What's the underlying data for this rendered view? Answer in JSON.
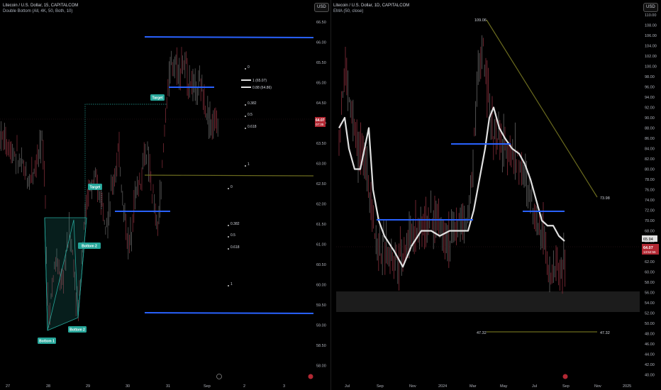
{
  "left": {
    "title": "Litecoin / U.S. Dollar, 15, CAPITALCOM",
    "indicator": "Double Bottom (All, 4K, 50, Both, 10)",
    "currency_label": "USD",
    "price_ticks": [
      "66.50",
      "66.00",
      "65.50",
      "65.00",
      "64.50",
      "64.00",
      "63.50",
      "63.00",
      "62.50",
      "62.00",
      "61.50",
      "61.00",
      "60.50",
      "60.00",
      "59.50",
      "59.00",
      "58.50",
      "58.00"
    ],
    "time_ticks": [
      "27",
      "28",
      "29",
      "30",
      "31",
      "Sep",
      "2",
      "3"
    ],
    "current_price": "64.07",
    "current_time": "07:35",
    "pattern_labels": {
      "bottom1": "Bottom 1",
      "bottom2": "Bottom 2",
      "bottom2b": "Bottom 2",
      "target1": "Target",
      "target2": "Target"
    },
    "fib_upper": {
      "l0": "0",
      "l1a": "1 (65.07)",
      "l1b": "0.88 (64.86)",
      "l382": "0.382",
      "l5": "0.5",
      "l618": "0.618",
      "l1": "1"
    },
    "fib_lower": {
      "l0": "0",
      "l382": "0.382",
      "l5": "0.5",
      "l618": "0.618",
      "l1": "1"
    }
  },
  "right": {
    "title": "Litecoin / U.S. Dollar, 1D, CAPITALCOM",
    "indicator": "EMA (50, close)",
    "currency_label": "USD",
    "price_ticks": [
      "110.00",
      "108.00",
      "106.00",
      "104.00",
      "102.00",
      "100.00",
      "98.00",
      "96.00",
      "94.00",
      "92.00",
      "90.00",
      "88.00",
      "86.00",
      "84.00",
      "82.00",
      "80.00",
      "78.00",
      "76.00",
      "74.00",
      "72.00",
      "70.00",
      "68.00",
      "66.00",
      "64.00",
      "62.00",
      "60.00",
      "58.00",
      "56.00",
      "54.00",
      "52.00",
      "50.00",
      "48.00",
      "46.00",
      "44.00",
      "42.00",
      "40.00"
    ],
    "time_ticks": [
      "Jul",
      "Sep",
      "Nov",
      "2024",
      "Mar",
      "May",
      "Jul",
      "Sep",
      "Nov",
      "2025"
    ],
    "current_price": "64.07",
    "current_time": "13:52:55",
    "ema_value": "65.94",
    "high_label": "109.06",
    "trend_end_label": "73.98",
    "low_label_left": "47.32",
    "low_label_right": "47.32"
  },
  "colors": {
    "blue": "#2962ff",
    "olive": "#6b6b1e",
    "green": "#26a69a",
    "ema": "#e0e0e0",
    "red_candle": "#7a2a35",
    "price_tag": "#b22833"
  }
}
